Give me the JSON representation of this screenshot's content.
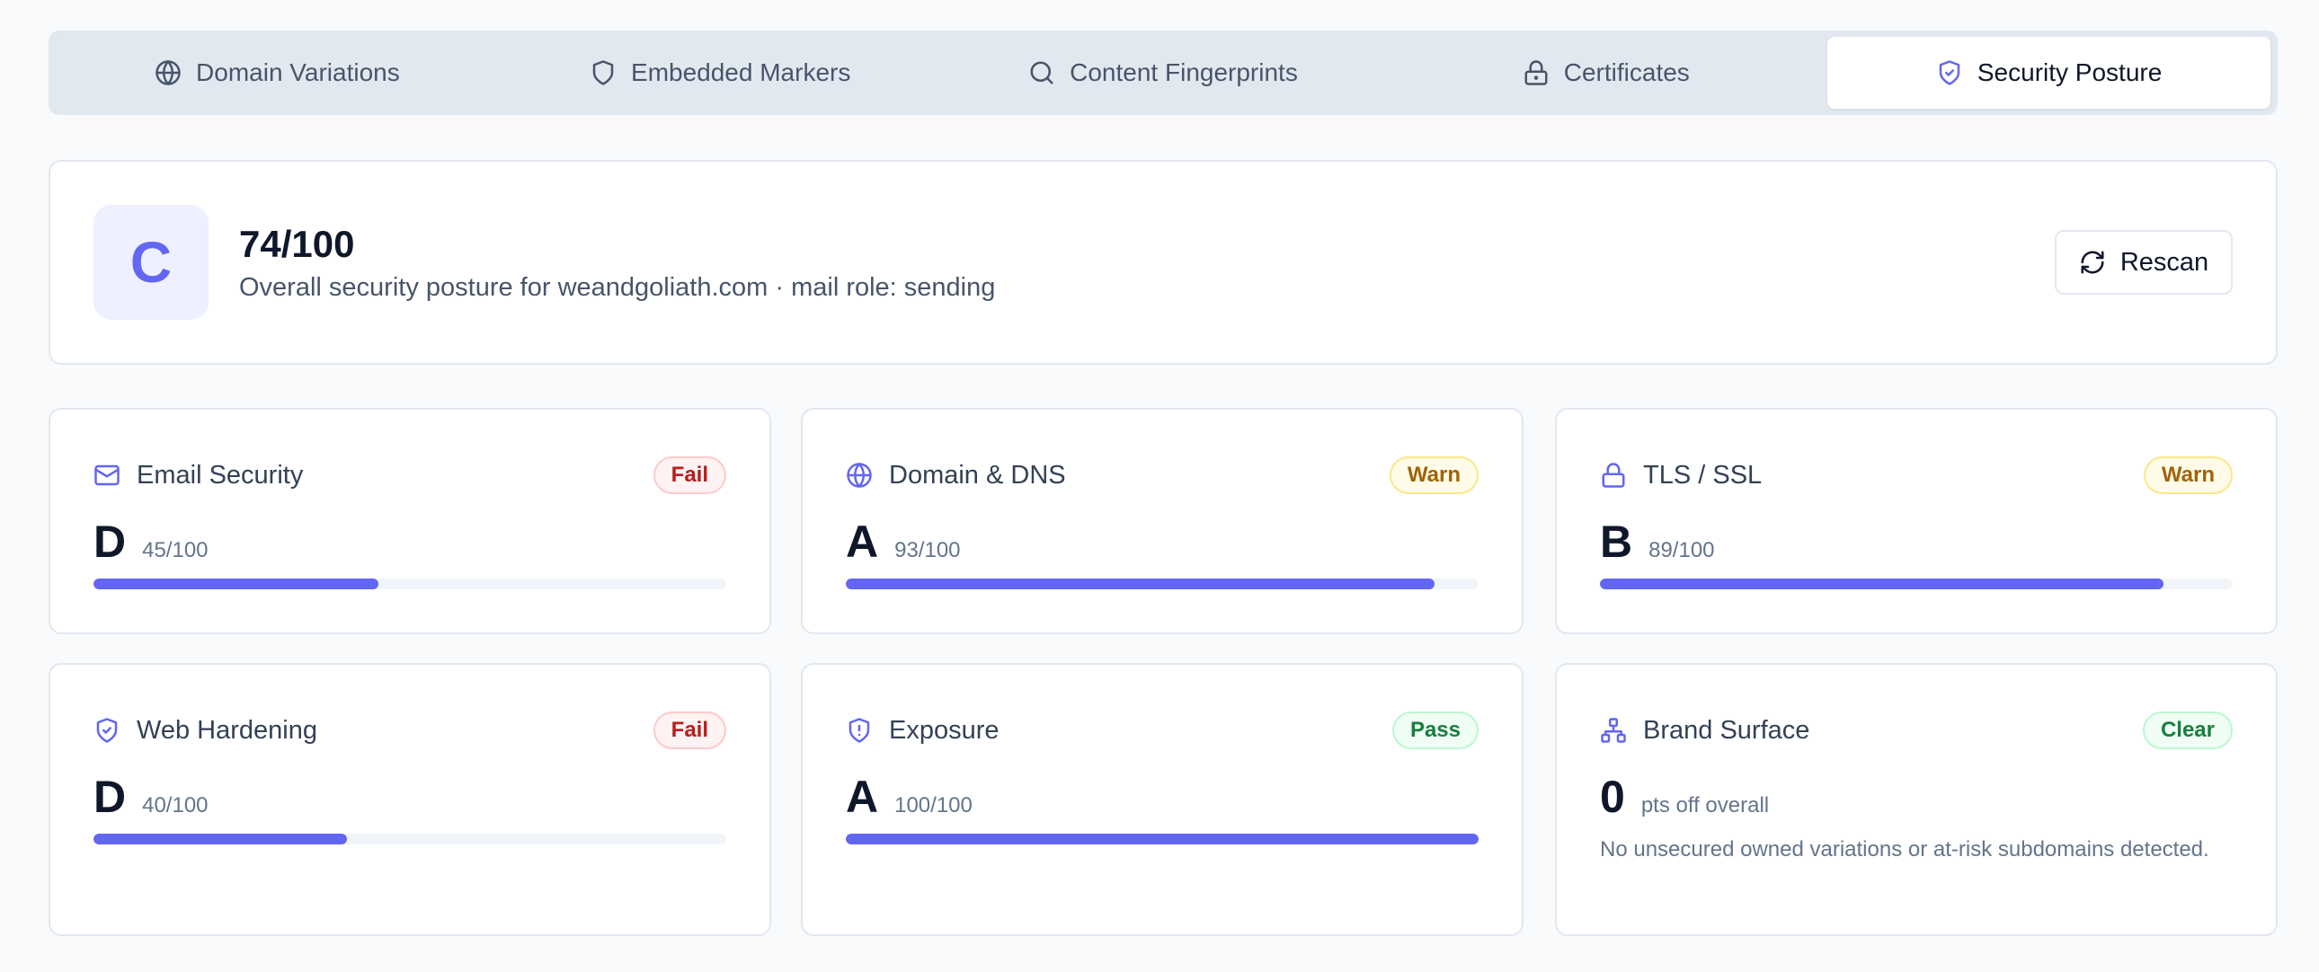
{
  "tabs": [
    {
      "label": "Domain Variations",
      "icon": "globe-icon"
    },
    {
      "label": "Embedded Markers",
      "icon": "shield-icon"
    },
    {
      "label": "Content Fingerprints",
      "icon": "search-icon"
    },
    {
      "label": "Certificates",
      "icon": "lock-icon"
    },
    {
      "label": "Security Posture",
      "icon": "shield-check-icon",
      "active": true
    }
  ],
  "overall": {
    "grade": "C",
    "score": "74/100",
    "description": "Overall security posture for weandgoliath.com · mail role: sending",
    "rescan_label": "Rescan"
  },
  "categories": [
    {
      "title": "Email Security",
      "icon": "mail-icon",
      "status": "Fail",
      "status_type": "fail",
      "grade": "D",
      "score": "45/100",
      "progress": 0.45
    },
    {
      "title": "Domain & DNS",
      "icon": "globe-icon",
      "status": "Warn",
      "status_type": "warn",
      "grade": "A",
      "score": "93/100",
      "progress": 0.93
    },
    {
      "title": "TLS / SSL",
      "icon": "lock-icon",
      "status": "Warn",
      "status_type": "warn",
      "grade": "B",
      "score": "89/100",
      "progress": 0.89
    },
    {
      "title": "Web Hardening",
      "icon": "shield-check-icon",
      "status": "Fail",
      "status_type": "fail",
      "grade": "D",
      "score": "40/100",
      "progress": 0.4
    },
    {
      "title": "Exposure",
      "icon": "shield-alert-icon",
      "status": "Pass",
      "status_type": "pass",
      "grade": "A",
      "score": "100/100",
      "progress": 1.0
    },
    {
      "title": "Brand Surface",
      "icon": "network-icon",
      "status": "Clear",
      "status_type": "clear",
      "grade": "0",
      "score": "pts off overall",
      "note": "No unsecured owned variations or at-risk subdomains detected."
    }
  ],
  "colors": {
    "accent": "#6366f1",
    "track": "#f1f5f9"
  }
}
